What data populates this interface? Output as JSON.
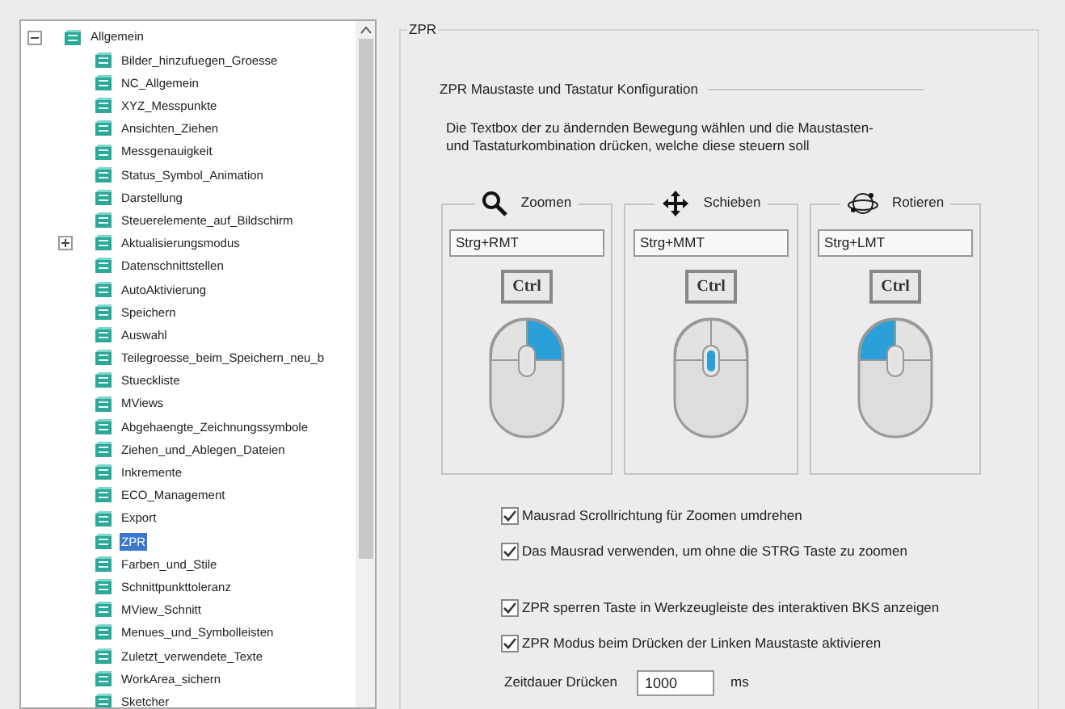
{
  "tree": {
    "label": "Allgemein",
    "expanded": true,
    "selected": false,
    "children": [
      {
        "label": "Bilder_hinzufuegen_Groesse",
        "selected": false
      },
      {
        "label": "NC_Allgemein",
        "selected": false
      },
      {
        "label": "XYZ_Messpunkte",
        "selected": false
      },
      {
        "label": "Ansichten_Ziehen",
        "selected": false
      },
      {
        "label": "Messgenauigkeit",
        "selected": false
      },
      {
        "label": "Status_Symbol_Animation",
        "selected": false
      },
      {
        "label": "Darstellung",
        "selected": false
      },
      {
        "label": "Steuerelemente_auf_Bildschirm",
        "selected": false
      },
      {
        "label": "Aktualisierungsmodus",
        "selected": false,
        "expanded": false
      },
      {
        "label": "Datenschnittstellen",
        "selected": false
      },
      {
        "label": "AutoAktivierung",
        "selected": false
      },
      {
        "label": "Speichern",
        "selected": false
      },
      {
        "label": "Auswahl",
        "selected": false
      },
      {
        "label": "Teilegroesse_beim_Speichern_neu_b",
        "selected": false
      },
      {
        "label": "Stueckliste",
        "selected": false
      },
      {
        "label": "MViews",
        "selected": false
      },
      {
        "label": "Abgehaengte_Zeichnungssymbole",
        "selected": false
      },
      {
        "label": "Ziehen_und_Ablegen_Dateien",
        "selected": false
      },
      {
        "label": "Inkremente",
        "selected": false
      },
      {
        "label": "ECO_Management",
        "selected": false
      },
      {
        "label": "Export",
        "selected": false
      },
      {
        "label": "ZPR",
        "selected": true
      },
      {
        "label": "Farben_und_Stile",
        "selected": false
      },
      {
        "label": "Schnittpunkttoleranz",
        "selected": false
      },
      {
        "label": "MView_Schnitt",
        "selected": false
      },
      {
        "label": "Menues_und_Symbolleisten",
        "selected": false
      },
      {
        "label": "Zuletzt_verwendete_Texte",
        "selected": false
      },
      {
        "label": "WorkArea_sichern",
        "selected": false
      },
      {
        "label": "Sketcher",
        "selected": false
      }
    ]
  },
  "panel": {
    "title": "ZPR",
    "section": "ZPR Maustaste und Tastatur Konfiguration",
    "description": "Die Textbox der zu ändernden Bewegung wählen und die Maustasten-\nund Tastaturkombination drücken, welche diese steuern soll",
    "actions": [
      {
        "kind": "zoom",
        "label": "Zoomen",
        "value": "Strg+RMT",
        "key": "Ctrl",
        "left_pressed": false,
        "middle_pressed": false,
        "right_pressed": true
      },
      {
        "kind": "pan",
        "label": "Schieben",
        "value": "Strg+MMT",
        "key": "Ctrl",
        "left_pressed": false,
        "middle_pressed": true,
        "right_pressed": false
      },
      {
        "kind": "rotate",
        "label": "Rotieren",
        "value": "Strg+LMT",
        "key": "Ctrl",
        "left_pressed": true,
        "middle_pressed": false,
        "right_pressed": false
      }
    ],
    "options": [
      {
        "label": "Mausrad Scrollrichtung für Zoomen umdrehen",
        "checked": true
      },
      {
        "label": "Das Mausrad verwenden, um ohne die STRG Taste zu zoomen",
        "checked": true
      },
      {
        "label": "ZPR sperren Taste in Werkzeugleiste des interaktiven BKS anzeigen",
        "checked": true
      },
      {
        "label": "ZPR Modus beim Drücken der Linken Maustaste aktivieren",
        "checked": true
      }
    ],
    "duration": {
      "label": "Zeitdauer Drücken",
      "value": "1000",
      "unit": "ms"
    }
  }
}
